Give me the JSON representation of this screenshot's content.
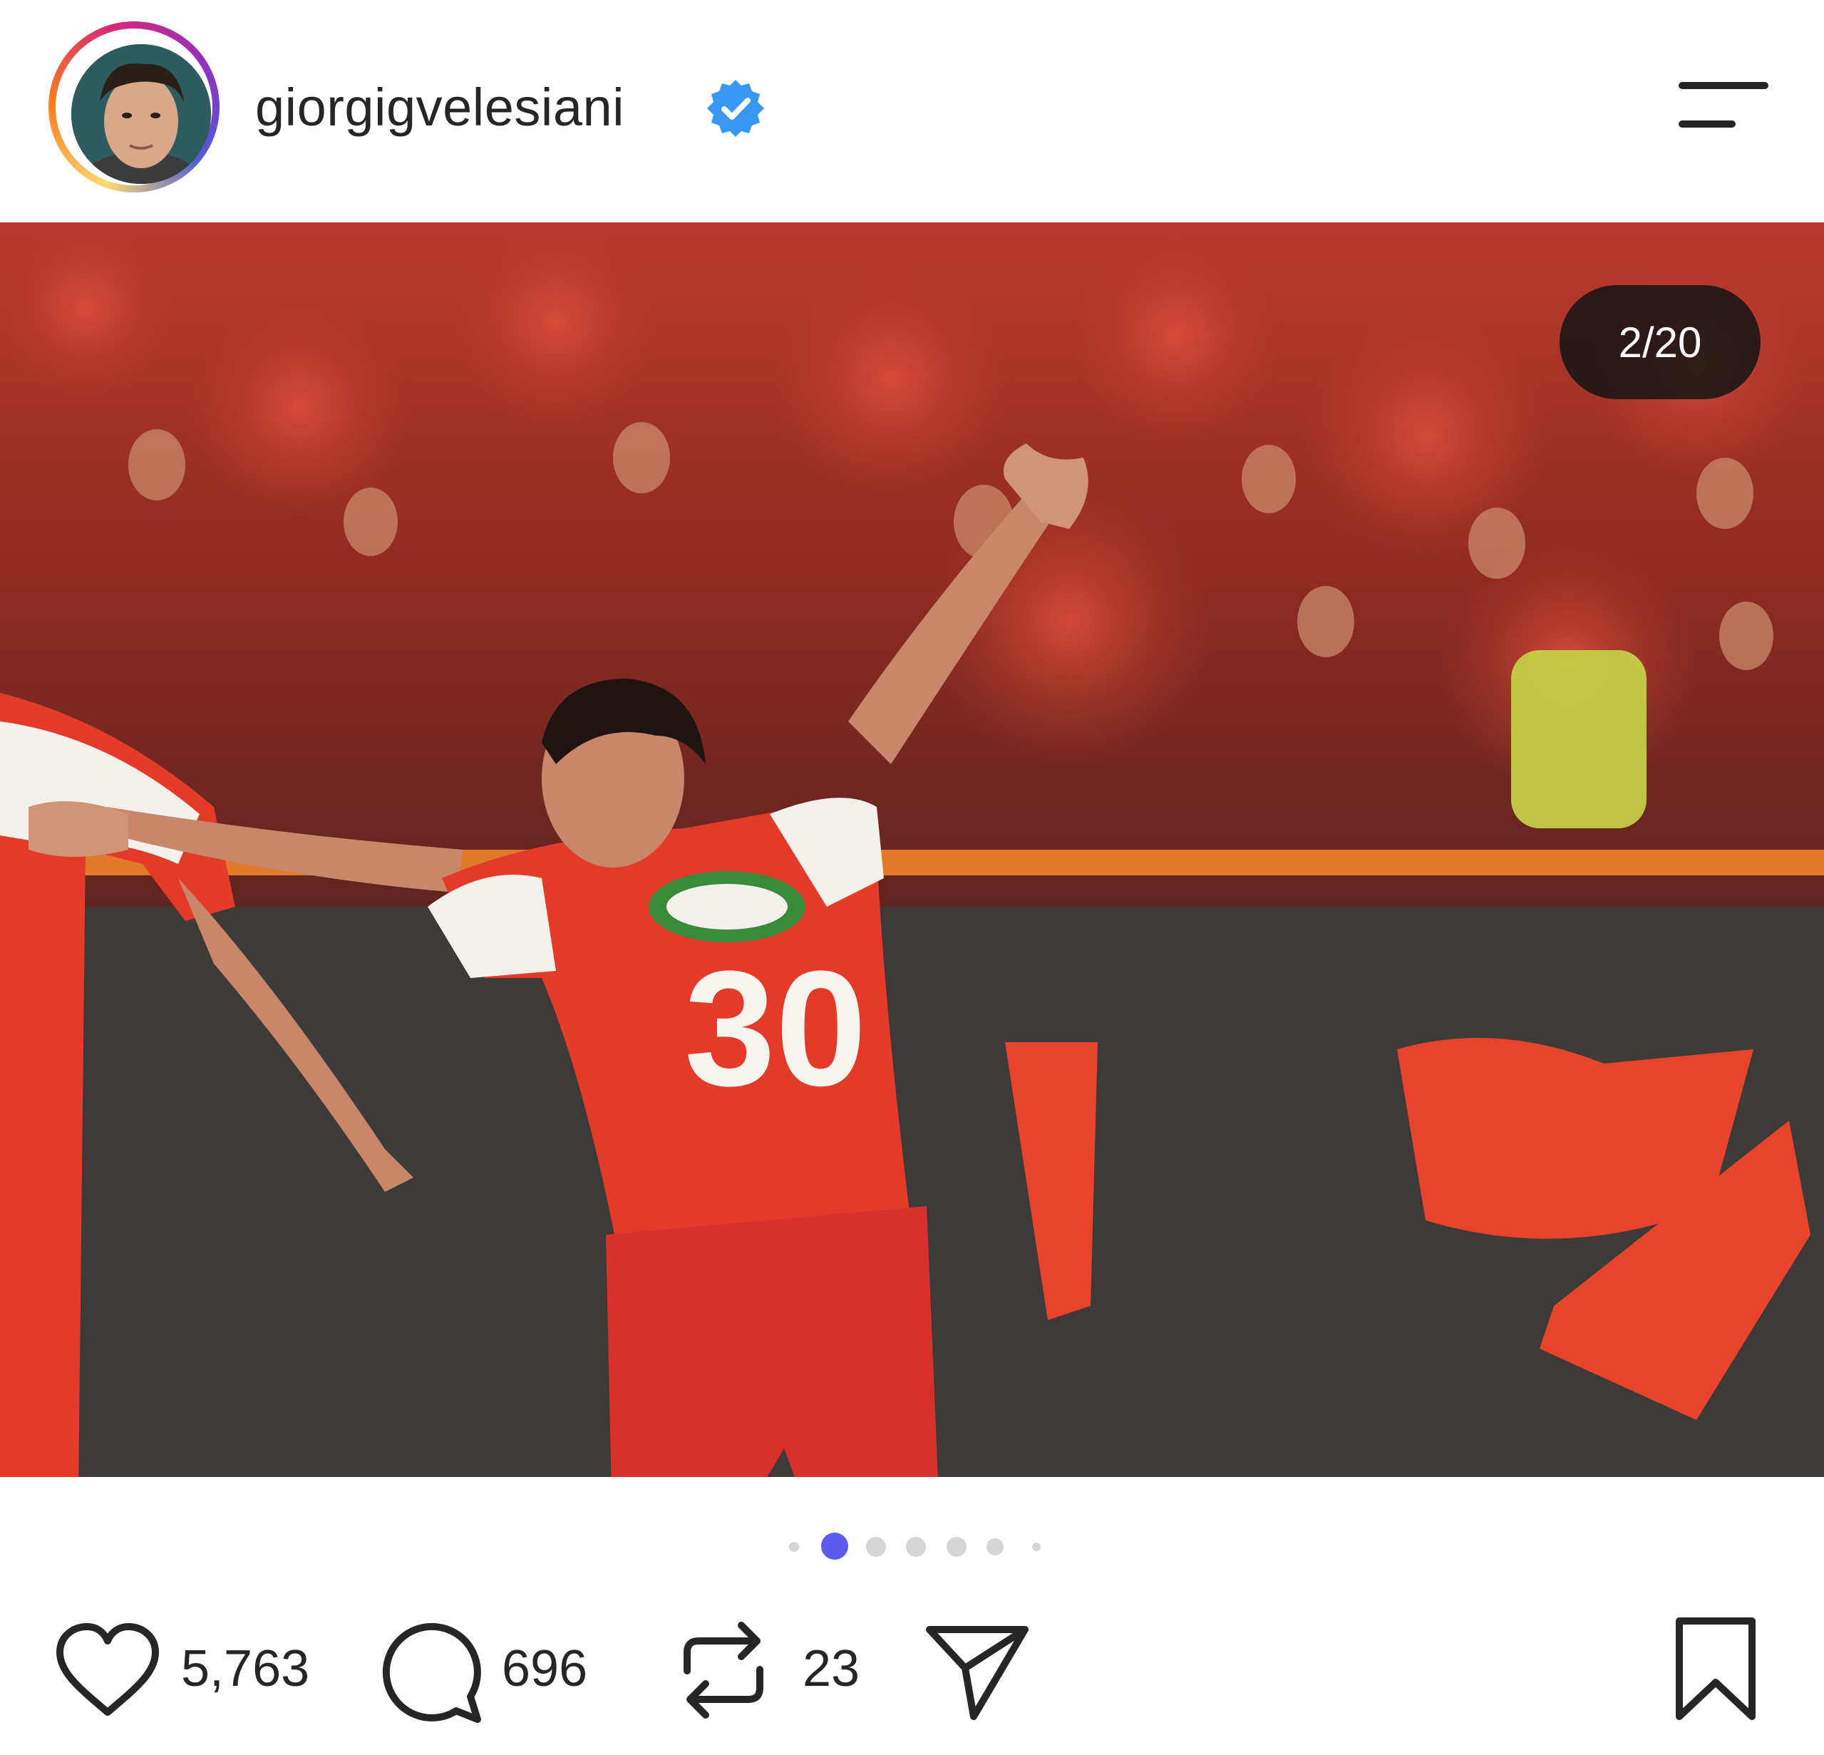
{
  "header": {
    "username": "giorgigvelesiani",
    "verified": true,
    "avatar_icon": "profile-avatar",
    "menu_icon": "menu-icon"
  },
  "post": {
    "media_counter": "2/20",
    "carousel": {
      "visible_dots": 7,
      "active_index": 1
    },
    "image_description_icon": "photo"
  },
  "actions": {
    "likes": "5,763",
    "comments": "696",
    "reposts": "23",
    "like_icon": "heart-icon",
    "comment_icon": "comment-icon",
    "repost_icon": "repost-icon",
    "share_icon": "send-icon",
    "save_icon": "bookmark-icon"
  },
  "colors": {
    "verified_blue": "#3897f0",
    "active_dot": "#5b5bf0",
    "inactive_dot": "#d6d6d6",
    "counter_bg": "#141414"
  }
}
